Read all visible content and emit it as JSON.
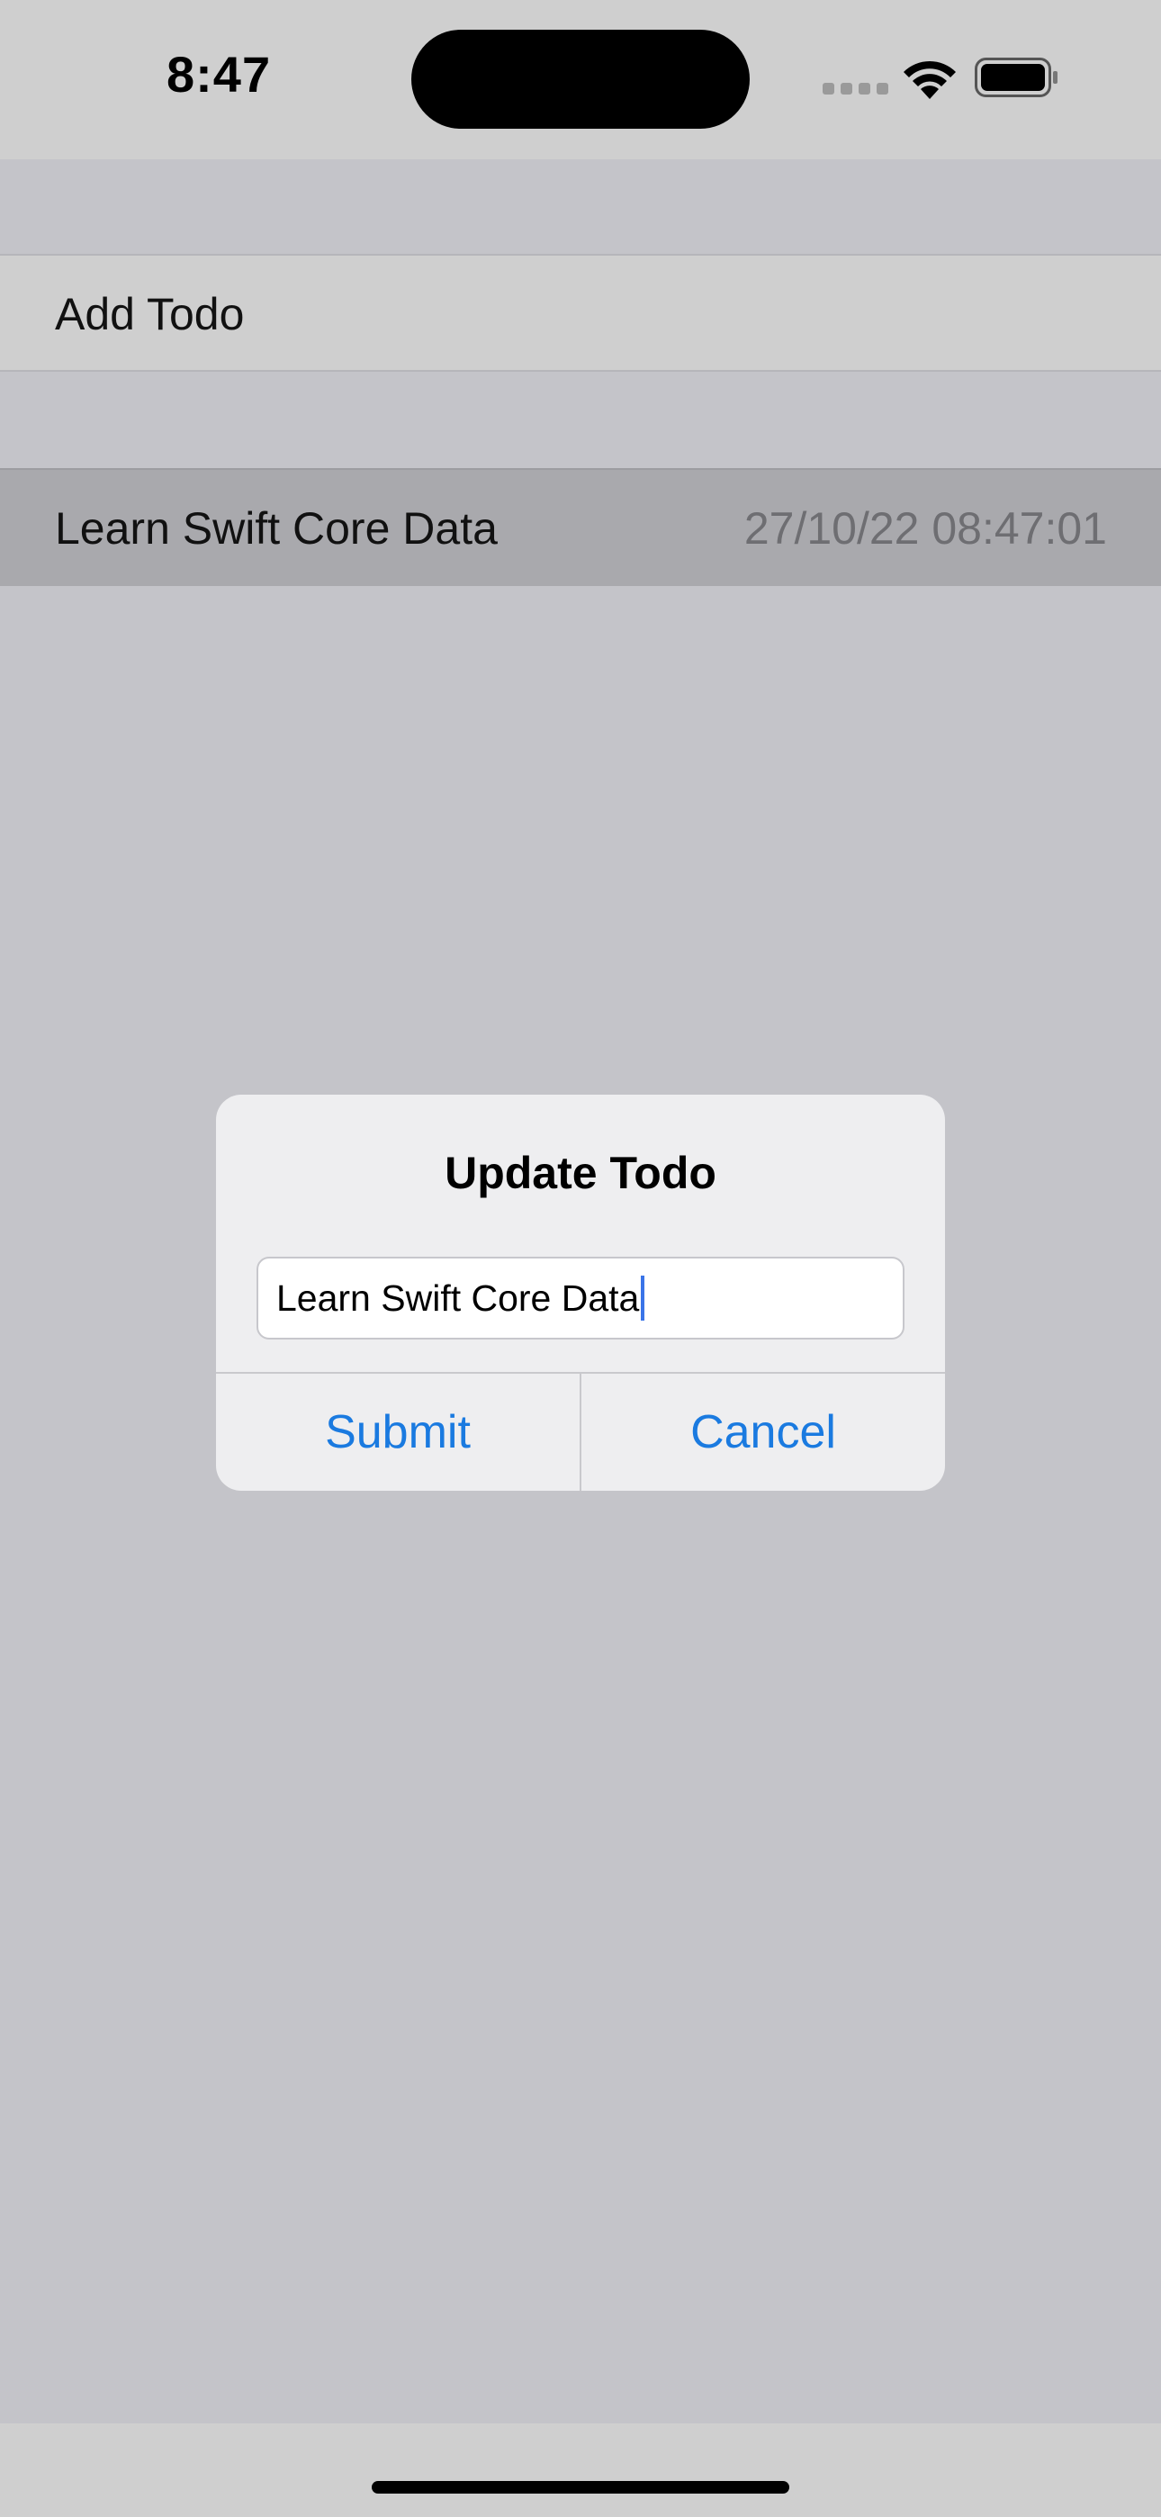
{
  "status_bar": {
    "time": "8:47",
    "icons": [
      "signal-icon",
      "wifi-icon",
      "battery-icon"
    ]
  },
  "list": {
    "add_label": "Add Todo",
    "items": [
      {
        "title": "Learn Swift Core Data",
        "date": "27/10/22 08:47:01"
      }
    ]
  },
  "dialog": {
    "title": "Update Todo",
    "input_value": "Learn Swift Core Data",
    "submit_label": "Submit",
    "cancel_label": "Cancel"
  },
  "colors": {
    "accent": "#1a7ae0",
    "background": "#c4c4c9",
    "dialog_background": "#eeeef0"
  }
}
